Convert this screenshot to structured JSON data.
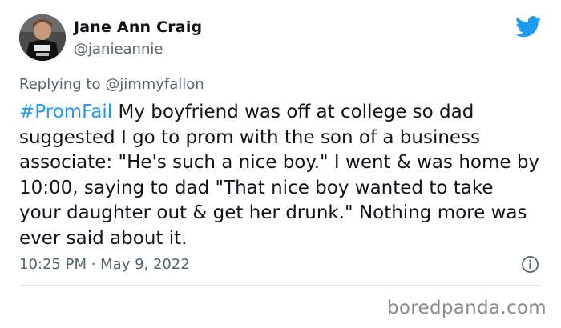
{
  "author": {
    "name": "Jane Ann Craig",
    "handle": "@janieannie",
    "avatar_icon": "user-avatar"
  },
  "reply": {
    "prefix": "Replying to ",
    "mention": "@jimmyfallon"
  },
  "tweet": {
    "hashtag": "#PromFail",
    "text": " My boyfriend was off at college so dad suggested I go to prom with the son of a business associate: \"He's such a nice boy.\" I went & was home by 10:00, saying to dad \"That nice boy wanted to take your daughter out & get her drunk.\" Nothing more was ever said about it."
  },
  "meta": {
    "timestamp": "10:25 PM · May 9, 2022",
    "info_icon": "info-icon"
  },
  "branding": {
    "platform_icon": "twitter-bird-icon",
    "watermark": "boredpanda.com"
  },
  "colors": {
    "accent": "#1d9bf0",
    "secondary_text": "#536471",
    "primary_text": "#0f1419"
  }
}
